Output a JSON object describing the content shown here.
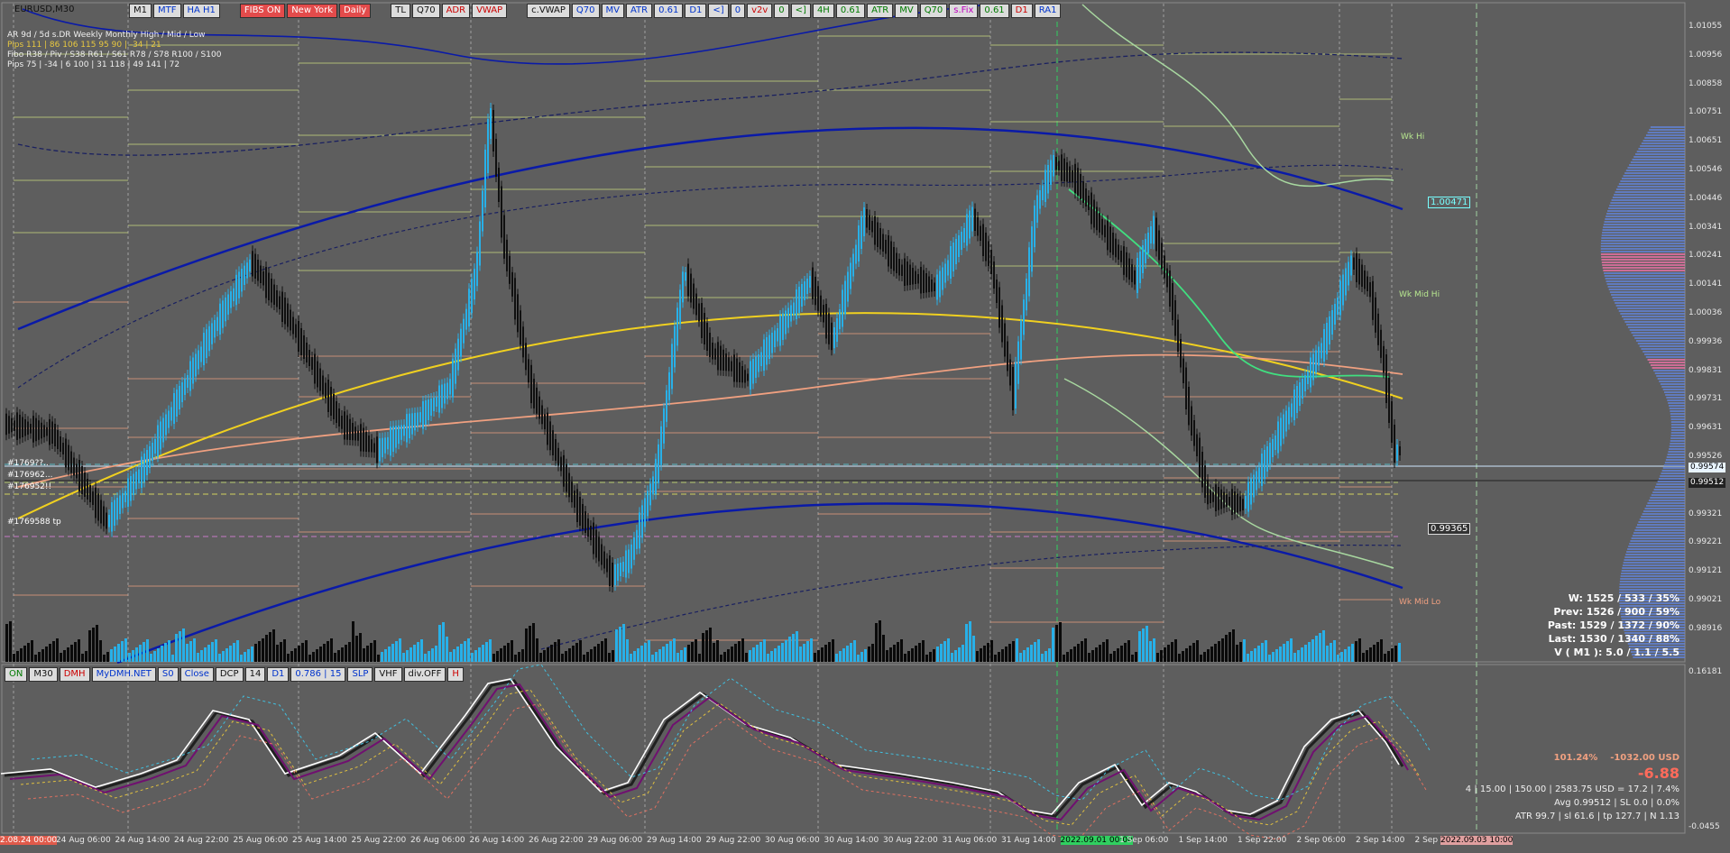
{
  "symbol_title": "EURUSD,M30",
  "top_toolbar": [
    {
      "label": "M1",
      "style": "blk"
    },
    {
      "label": "MTF",
      "style": ""
    },
    {
      "label": "HA H1",
      "style": ""
    },
    {
      "label": "FIBS ON",
      "style": "redbg"
    },
    {
      "label": "New York",
      "style": "redbg"
    },
    {
      "label": "Daily",
      "style": "redbg"
    },
    {
      "label": "TL",
      "style": "blk"
    },
    {
      "label": "Q70",
      "style": "blk"
    },
    {
      "label": "ADR",
      "style": "red"
    },
    {
      "label": "VWAP",
      "style": "red"
    },
    {
      "label": "c.VWAP",
      "style": "blk"
    },
    {
      "label": "Q70",
      "style": ""
    },
    {
      "label": "MV",
      "style": ""
    },
    {
      "label": "ATR",
      "style": ""
    },
    {
      "label": "0.61",
      "style": ""
    },
    {
      "label": "D1",
      "style": ""
    },
    {
      "label": "<]",
      "style": ""
    },
    {
      "label": "0",
      "style": ""
    },
    {
      "label": "v2v",
      "style": "red"
    },
    {
      "label": "0",
      "style": "grn"
    },
    {
      "label": "<]",
      "style": "grn"
    },
    {
      "label": "4H",
      "style": "grn"
    },
    {
      "label": "0.61",
      "style": "grn"
    },
    {
      "label": "ATR",
      "style": "grn"
    },
    {
      "label": "MV",
      "style": "grn"
    },
    {
      "label": "Q70",
      "style": "grn"
    },
    {
      "label": "s.Fix",
      "style": "mag"
    },
    {
      "label": "0.61",
      "style": "grn"
    },
    {
      "label": "D1",
      "style": "red"
    },
    {
      "label": "RA1",
      "style": ""
    }
  ],
  "bottom_toolbar": [
    {
      "label": "ON",
      "style": "grn"
    },
    {
      "label": "M30",
      "style": "blk"
    },
    {
      "label": "DMH",
      "style": "red"
    },
    {
      "label": "MyDMH.NET",
      "style": ""
    },
    {
      "label": "S0",
      "style": ""
    },
    {
      "label": "Close",
      "style": ""
    },
    {
      "label": "DCP",
      "style": "blk"
    },
    {
      "label": "14",
      "style": "blk"
    },
    {
      "label": "D1",
      "style": ""
    },
    {
      "label": "0.786 | 15",
      "style": ""
    },
    {
      "label": "SLP",
      "style": ""
    },
    {
      "label": "VHF",
      "style": "blk"
    },
    {
      "label": "div.OFF",
      "style": "blk"
    },
    {
      "label": "H",
      "style": "red"
    }
  ],
  "info_panel": {
    "row1": "AR    9d / 5d      s.DR        Weekly       Monthly         High / Mid / Low",
    "row2": "Pips   111 | 86       106           115            95               90   |  -34  |  21",
    "row3": "Fibo   R38 / Piv / S38      R61 / S61       R78 / S78       R100 / S100",
    "row4": "Pips    75  |  -34  |  6         100  |  31        118  |  49        141  |  72"
  },
  "price_axis": [
    "1.01055",
    "1.00956",
    "1.00858",
    "1.00751",
    "1.00651",
    "1.00546",
    "1.00446",
    "1.00341",
    "1.00241",
    "1.00141",
    "1.00036",
    "0.99936",
    "0.99831",
    "0.99731",
    "0.99631",
    "0.99526",
    "0.99426",
    "0.99321",
    "0.99221",
    "0.99121",
    "0.99021",
    "0.98916"
  ],
  "osc_axis": {
    "top": "0.16181",
    "bottom": "-0.0455"
  },
  "price_tags": {
    "bid": "0.99574",
    "ask": "0.99512",
    "level1": "1.00471",
    "level2": "0.99365"
  },
  "time_axis": [
    "2.08.24 00:00",
    "24 Aug 06:00",
    "24 Aug 14:00",
    "24 Aug 22:00",
    "25 Aug 06:00",
    "25 Aug 14:00",
    "25 Aug 22:00",
    "26 Aug 06:00",
    "26 Aug 14:00",
    "26 Aug 22:00",
    "29 Aug 06:00",
    "29 Aug 14:00",
    "29 Aug 22:00",
    "30 Aug 06:00",
    "30 Aug 14:00",
    "30 Aug 22:00",
    "31 Aug 06:00",
    "31 Aug 14:00",
    "2022.09.01 00:00",
    "1 Sep 06:00",
    "1 Sep 14:00",
    "1 Sep 22:00",
    "2 Sep 06:00",
    "2 Sep 14:00",
    "2 Sep 22:00",
    "2022.09.03 10:00"
  ],
  "stats": [
    "W: 1525 / 533 / 35%",
    "Prev: 1526 / 900 / 59%",
    "Past: 1529 / 1372 / 90%",
    "Last: 1530 / 1340 / 88%",
    "V ( M1 ): 5.0 / 1.1 / 5.5"
  ],
  "account": {
    "pct": "101.24%",
    "usd": "-1032.00 USD",
    "big": "-6.88",
    "line1": "4  |  15.00  |  150.00  |  2583.75 USD = 17.2  |  7.4%",
    "line2": "Avg 0.99512  |  SL 0.0  |  0.0%",
    "line3": "ATR 99.7  |  sl 61.6  |  tp 127.7  |  N 1.13"
  },
  "trade_labels": [
    "#1769??..",
    "#176962...",
    "#176952!!",
    "#1769588 tp"
  ],
  "wk_labels": {
    "hi": "Wk Hi",
    "midhi": "Wk Mid Hi",
    "midlo": "Wk Mid Lo"
  },
  "colors": {
    "bg": "#5e5e5e",
    "bull": "#28b0e8",
    "bear": "#101010",
    "vwap_upper": "#0a1aa8",
    "yellow": "#f0d020",
    "salmon": "#f0a080",
    "green": "#40e080",
    "pivot_r": "#c8d880",
    "pivot_s": "#e8a080"
  }
}
